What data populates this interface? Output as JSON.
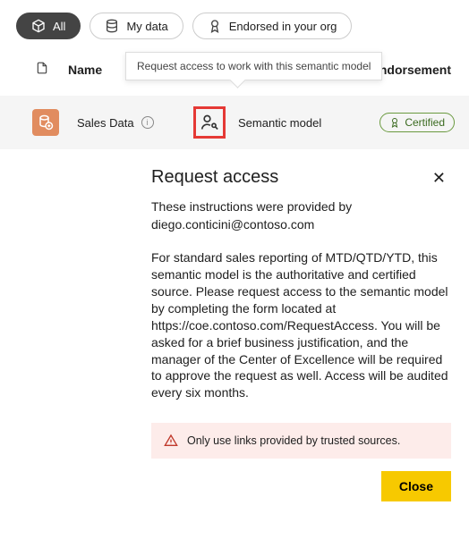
{
  "filters": {
    "all": "All",
    "mydata": "My data",
    "endorsed": "Endorsed in your org"
  },
  "columns": {
    "name": "Name",
    "endorsement": "Endorsement"
  },
  "tooltip": "Request access to work with this semantic model",
  "row": {
    "name": "Sales Data",
    "type": "Semantic model",
    "badge": "Certified"
  },
  "dialog": {
    "title": "Request access",
    "intro": "These instructions were provided by diego.conticini@contoso.com",
    "body": "For standard sales reporting of MTD/QTD/YTD, this semantic model is the authoritative and certified source. Please request access to the semantic model by completing the form located at https://coe.contoso.com/RequestAccess. You will be asked for a brief business justification, and the manager of the Center of Excellence will be required to approve the request as well. Access will be audited every six months.",
    "warning": "Only use links provided by trusted sources.",
    "close": "Close"
  }
}
